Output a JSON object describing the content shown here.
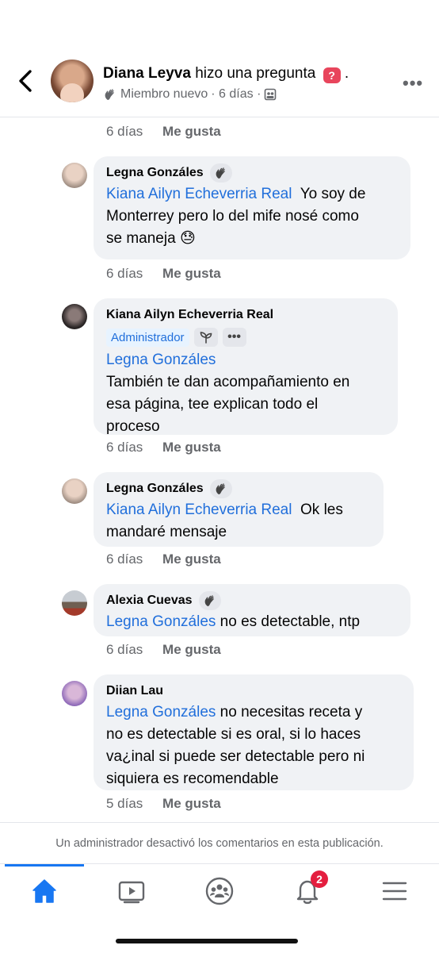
{
  "header": {
    "author": "Diana Leyva",
    "action": "hizo una pregunta",
    "question_icon": "?",
    "period": ".",
    "member_status": "Miembro nuevo",
    "time": "· 6 días ·"
  },
  "first_meta": {
    "time": "6 días",
    "like": "Me gusta"
  },
  "comments": [
    {
      "author": "Legna Gonzáles",
      "mention": "Kiana Ailyn Echeverria Real",
      "line1_rest": "Yo soy de",
      "line2": "Monterrey pero lo del mife nosé como",
      "line3": "se maneja 😓",
      "time": "6 días",
      "like": "Me gusta"
    },
    {
      "author": "Kiana Ailyn Echeverria Real",
      "badge": "Administrador",
      "mention": "Legna Gonzáles",
      "line1": "También te dan acompañamiento en",
      "line2": "esa página, tee explican todo el",
      "line3": "proceso",
      "time": "6 días",
      "like": "Me gusta"
    },
    {
      "author": "Legna Gonzáles",
      "mention": "Kiana Ailyn Echeverria Real",
      "line1_rest": "Ok les",
      "line2": "mandaré mensaje",
      "time": "6 días",
      "like": "Me gusta"
    },
    {
      "author": "Alexia Cuevas",
      "mention": "Legna Gonzáles",
      "line1_rest": "no es detectable, ntp",
      "time": "6 días",
      "like": "Me gusta"
    },
    {
      "author": "Diian Lau",
      "mention": "Legna Gonzáles",
      "line1_rest": "no necesitas receta y",
      "line2": "no es detectable si es oral, si lo haces",
      "line3": "va¿inal si puede ser detectable pero ni",
      "line4": "siquiera es recomendable",
      "time": "5 días",
      "like": "Me gusta"
    }
  ],
  "footer_note": "Un administrador desactivó los comentarios en esta publicación.",
  "tabbar": {
    "active_tab": "home",
    "notifications_count": "2",
    "accent_color": "#1877f2"
  },
  "icons": [
    "back-icon",
    "wave-icon",
    "group-icon",
    "more-icon",
    "home-icon",
    "video-icon",
    "groups-icon",
    "bell-icon",
    "menu-icon",
    "plant-icon"
  ]
}
